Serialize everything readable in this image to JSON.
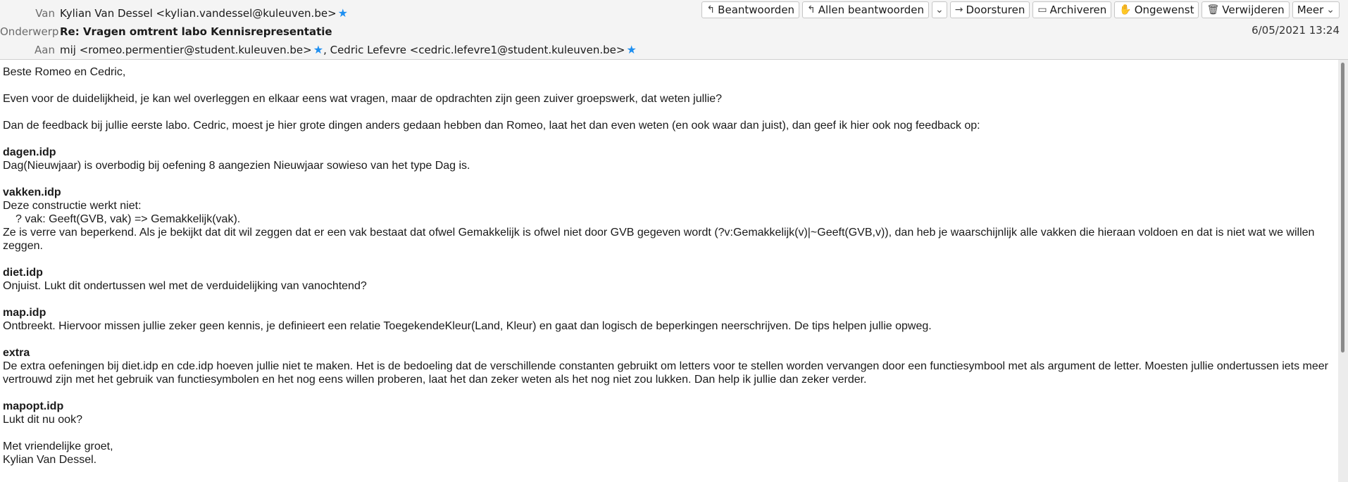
{
  "header": {
    "from_label": "Van",
    "from_value": "Kylian Van Dessel <kylian.vandessel@kuleuven.be>",
    "subject_label": "Onderwerp",
    "subject_value": "Re: Vragen omtrent labo Kennisrepresentatie",
    "to_label": "Aan",
    "to_value_1": "mij <romeo.permentier@student.kuleuven.be>",
    "to_separator": ", ",
    "to_value_2": "Cedric Lefevre <cedric.lefevre1@student.kuleuven.be>",
    "date": "6/05/2021 13:24",
    "star_icon": "★",
    "star_color": "#1e8ff0"
  },
  "toolbar": {
    "reply": "Beantwoorden",
    "reply_all": "Allen beantwoorden",
    "forward": "Doorsturen",
    "archive": "Archiveren",
    "junk": "Ongewenst",
    "delete": "Verwijderen",
    "more": "Meer"
  },
  "body": {
    "greeting": "Beste Romeo en Cedric,",
    "p1": "Even voor de duidelijkheid, je kan wel overleggen en elkaar eens wat vragen, maar de opdrachten zijn geen zuiver groepswerk, dat weten jullie?",
    "p2": "Dan de feedback bij jullie eerste labo. Cedric, moest je hier grote dingen anders gedaan hebben dan Romeo, laat het dan even weten (en ook waar dan juist), dan geef ik hier ook nog feedback op:",
    "s1_title": "dagen.idp",
    "s1_text": "Dag(Nieuwjaar) is overbodig bij oefening 8 aangezien Nieuwjaar sowieso van het type Dag is.",
    "s2_title": "vakken.idp",
    "s2_line1": "Deze constructie werkt niet:",
    "s2_code": "? vak: Geeft(GVB, vak) => Gemakkelijk(vak).",
    "s2_line2": "Ze is verre van beperkend. Als je bekijkt dat dit wil zeggen dat er een vak bestaat dat ofwel Gemakkelijk is ofwel niet door GVB gegeven wordt (?v:Gemakkelijk(v)|~Geeft(GVB,v)), dan heb je waarschijnlijk alle vakken die hieraan voldoen en dat is niet wat we willen zeggen.",
    "s3_title": "diet.idp",
    "s3_text": "Onjuist. Lukt dit ondertussen wel met de verduidelijking van vanochtend?",
    "s4_title": "map.idp",
    "s4_text": "Ontbreekt. Hiervoor missen jullie zeker geen kennis, je definieert een relatie ToegekendeKleur(Land, Kleur) en gaat dan logisch de beperkingen neerschrijven. De tips helpen jullie opweg.",
    "s5_title": "extra",
    "s5_text": "De extra oefeningen bij diet.idp en cde.idp hoeven jullie niet te maken. Het is de bedoeling dat de verschillende constanten gebruikt om letters voor te stellen worden vervangen door een functiesymbool met als argument de letter.  Moesten jullie ondertussen iets meer vertrouwd zijn met het gebruik van functiesymbolen en het nog eens willen proberen, laat het dan zeker weten als het nog niet zou lukken. Dan help ik jullie dan zeker verder.",
    "s6_title": "mapopt.idp",
    "s6_text": "Lukt dit nu ook?",
    "closing": "Met vriendelijke groet,",
    "signature": "Kylian Van Dessel."
  }
}
